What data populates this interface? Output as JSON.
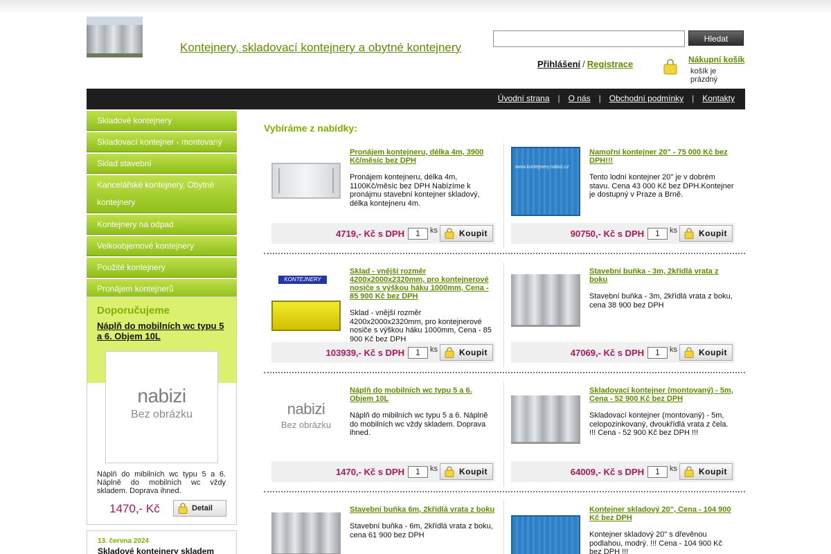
{
  "header": {
    "site_title": "Kontejnery, skladovací kontejnery a obytné kontejnery",
    "search_button": "Hledat",
    "search_value": "",
    "login": "Přihlášení",
    "separator": "/",
    "register": "Registrace",
    "cart_title": "Nákupní košík",
    "cart_status": "košík je prázdný"
  },
  "topnav": {
    "items": [
      "Úvodní strana",
      "O nás",
      "Obchodní podmínky",
      "Kontakty"
    ],
    "separator": "|"
  },
  "sidebar": {
    "menu": [
      "Skladové kontejnery",
      "Skladovací kontejner - montovaný",
      "Sklad stavební",
      "Kancelářské kontejnery, Obytné kontejnery",
      "Kontejnery na odpad",
      "Velkoobjemové kontejnery",
      "Použité kontejnery",
      "Pronájem kontejnerů"
    ],
    "recommend": {
      "title": "Doporučujeme",
      "product": "Náplň do mobilních wc typu 5 a 6. Objem 10L",
      "noimg_logo": "nabizi",
      "noimg_text": "Bez obrázku",
      "desc": "Náplň do mibilních wc typu 5 a 6. Náplně do mobilních wc vždy skladem. Doprava ihned.",
      "price": "1470,- Kč",
      "detail": "Detail"
    },
    "news": {
      "date": "13. června 2024",
      "title": "Skladové kontejnery skladem"
    }
  },
  "main": {
    "heading": "Vybíráme z nabídky:",
    "qty_unit": "ks",
    "buy_label": "Koupit",
    "products": [
      {
        "name": "Pronájem kontejneru, délka 4m, 3900 Kč/měsíc bez DPH",
        "desc": "Pronájem kontejneru, délka 4m, 1100Kč/měsíc bez DPH Nabízíme k pronájmu stavební kontejner skladový, délka kontejneru 4m.",
        "price": "4719,- Kč s DPH",
        "qty": "1"
      },
      {
        "name": "Namořní kontejner 20\" - 75 000 Kč bez DPH!!!",
        "desc": "Tento lodní kontejner 20\" je v dobrém stavu. Cena 43 000 Kč bez DPH.Kontejner je dostupný v Praze a Brně.",
        "price": "90750,- Kč s DPH",
        "qty": "1",
        "img_caption": "www.kontejnery.nabizi.cz"
      },
      {
        "name": "Sklad - vnější rozměr 4200x2000x2320mm, pro kontejnerové nosiče s výškou háku 1000mm, Cena - 85 900 Kč bez DPH",
        "desc": "Sklad - vnější rozměr 4200x2000x2320mm, pro kontejnerové nosiče s výškou háku 1000mm, Cena - 85 900 Kč bez DPH",
        "price": "103939,- Kč s DPH",
        "qty": "1",
        "img_caption": "KONTEJNERY"
      },
      {
        "name": "Stavební buňka - 3m, 2křídlá vrata z boku",
        "desc": "Stavební buňka - 3m, 2křídlá vrata z boku, cena 38 900 bez DPH",
        "price": "47069,- Kč s DPH",
        "qty": "1"
      },
      {
        "name": "Náplň do mobilních wc typu 5 a 6. Objem 10L",
        "desc": "Náplň do mibilních wc typu 5 a 6. Náplně do mobilních wc vždy skladem. Doprava ihned.",
        "price": "1470,- Kč s DPH",
        "qty": "1",
        "noimg_logo": "nabizi",
        "noimg_text": "Bez obrázku"
      },
      {
        "name": "Skladovací kontejner (montovaný) - 5m, Cena - 52 900 Kč bez DPH",
        "desc": "Skladovací kontejner (montovaný) - 5m, celopozinkovaný, dvoukřídlá vrata z čela. !!! Cena - 52 900 Kč bez DPH !!!",
        "price": "64009,- Kč s DPH",
        "qty": "1"
      },
      {
        "name": "Stavební buňka 6m, 2křídlá vrata z boku",
        "desc": "Stavební buňka - 6m, 2křídlá vrata z boku, cena 61 900 bez DPH"
      },
      {
        "name": "Kontejner skladový 20\", Cena - 104 900 Kč bez DPH",
        "desc": "Kontejner skladový 20\" s dřevěnou podlahou, modrý. !!! Cena - 104 900 Kč bez DPH !!!"
      }
    ]
  },
  "colors": {
    "accent_green": "#7fb000",
    "link_green": "#5f8c00",
    "price_magenta": "#a8185a",
    "nav_dark": "#1e1e1e"
  }
}
